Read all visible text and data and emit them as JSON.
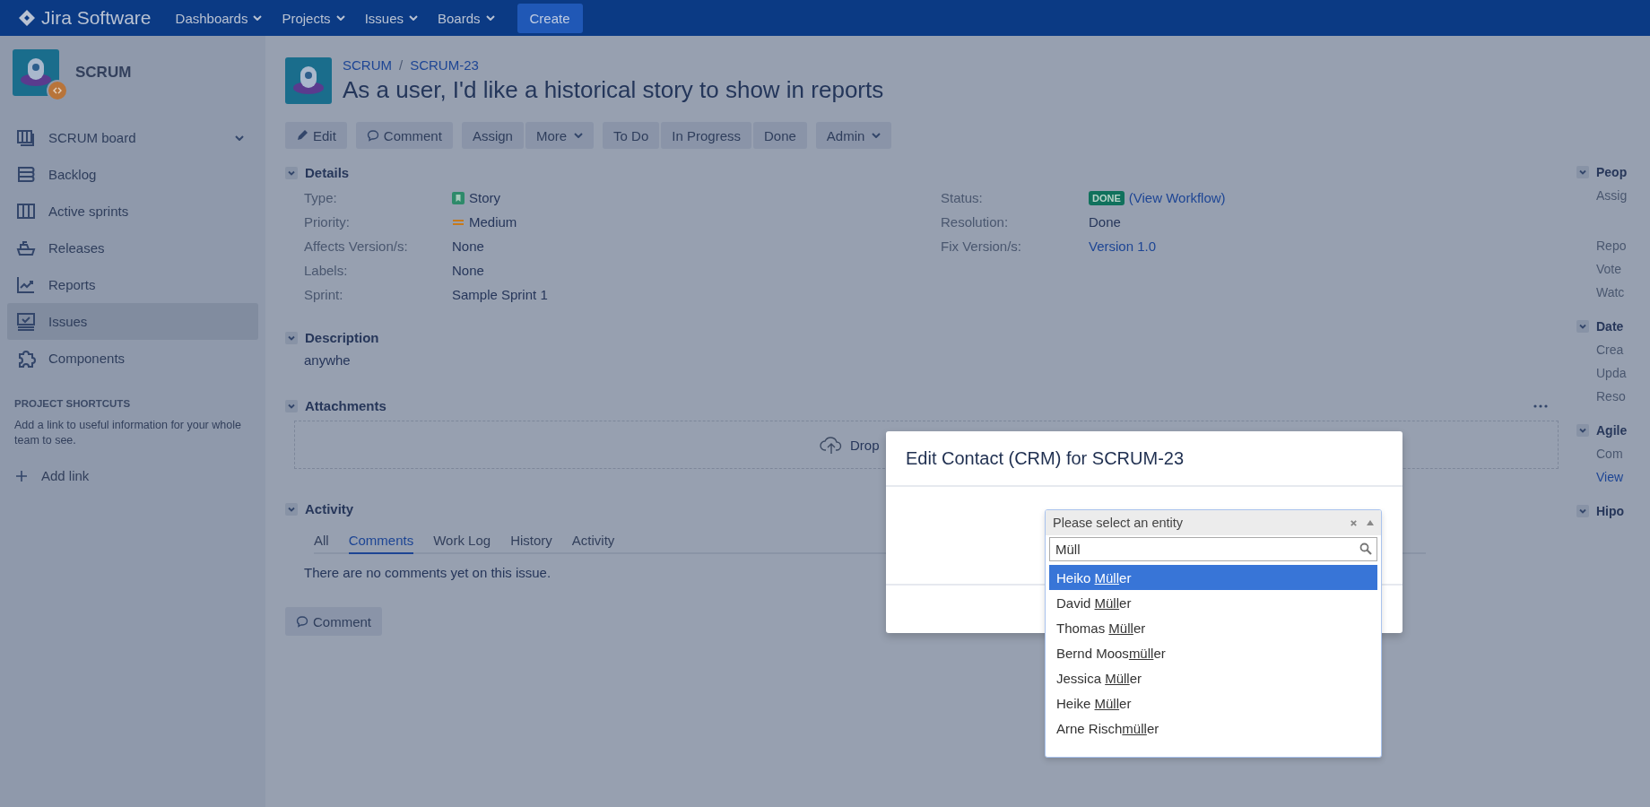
{
  "top_nav": {
    "logo": "Jira Software",
    "menus": [
      {
        "label": "Dashboards"
      },
      {
        "label": "Projects"
      },
      {
        "label": "Issues"
      },
      {
        "label": "Boards"
      }
    ],
    "create": "Create"
  },
  "sidebar": {
    "project": "SCRUM",
    "items": [
      {
        "label": "SCRUM board",
        "selected": false
      },
      {
        "label": "Backlog",
        "selected": false
      },
      {
        "label": "Active sprints",
        "selected": false
      },
      {
        "label": "Releases",
        "selected": false
      },
      {
        "label": "Reports",
        "selected": false
      },
      {
        "label": "Issues",
        "selected": true
      },
      {
        "label": "Components",
        "selected": false
      }
    ],
    "shortcuts_title": "PROJECT SHORTCUTS",
    "shortcuts_text": "Add a link to useful information for your whole team to see.",
    "add_link": "Add link"
  },
  "issue": {
    "breadcrumbs": [
      "SCRUM",
      "SCRUM-23"
    ],
    "breadcrumb_separator": "/",
    "title": "As a user, I'd like a historical story to show in reports"
  },
  "toolbar": [
    [
      {
        "label": "Edit",
        "menu": false
      }
    ],
    [
      {
        "label": "Comment",
        "menu": false
      }
    ],
    [
      {
        "label": "Assign",
        "menu": false
      },
      {
        "label": "More",
        "menu": true
      }
    ],
    [
      {
        "label": "To Do",
        "menu": false
      },
      {
        "label": "In Progress",
        "menu": false
      },
      {
        "label": "Done",
        "menu": false
      }
    ],
    [
      {
        "label": "Admin",
        "menu": true
      }
    ]
  ],
  "details": {
    "title": "Details",
    "left": [
      {
        "label": "Type:",
        "value": "Story",
        "kind": "story"
      },
      {
        "label": "Priority:",
        "value": "Medium",
        "kind": "priority"
      },
      {
        "label": "Affects Version/s:",
        "value": "None",
        "kind": "text"
      },
      {
        "label": "Labels:",
        "value": "None",
        "kind": "text"
      },
      {
        "label": "Sprint:",
        "value": "Sample Sprint 1",
        "kind": "text"
      }
    ],
    "right": [
      {
        "label": "Status:",
        "value": "DONE",
        "link": "(View Workflow)",
        "kind": "status"
      },
      {
        "label": "Resolution:",
        "value": "Done",
        "kind": "text"
      },
      {
        "label": "Fix Version/s:",
        "value": "Version 1.0",
        "kind": "link"
      }
    ]
  },
  "description": {
    "title": "Description",
    "text": "anywhe"
  },
  "attachments": {
    "title": "Attachments",
    "drop_text": "Drop"
  },
  "activity": {
    "title": "Activity",
    "tabs": [
      {
        "label": "All",
        "selected": false
      },
      {
        "label": "Comments",
        "selected": true
      },
      {
        "label": "Work Log",
        "selected": false
      },
      {
        "label": "History",
        "selected": false
      },
      {
        "label": "Activity",
        "selected": false
      }
    ],
    "empty_text": "There are no comments yet on this issue.",
    "comment_button": "Comment"
  },
  "right_panel": [
    {
      "title": "Peop",
      "items": [
        {
          "label": "Assig",
          "kind": "text"
        },
        {
          "label": "Repo",
          "kind": "text"
        },
        {
          "label": "Vote",
          "kind": "text"
        },
        {
          "label": "Watc",
          "kind": "text"
        }
      ]
    },
    {
      "title": "Date",
      "items": [
        {
          "label": "Crea",
          "kind": "text"
        },
        {
          "label": "Upda",
          "kind": "text"
        },
        {
          "label": "Reso",
          "kind": "text"
        }
      ]
    },
    {
      "title": "Agile",
      "items": [
        {
          "label": "Com",
          "kind": "text"
        },
        {
          "label": "View",
          "kind": "link"
        }
      ]
    },
    {
      "title": "Hipo"
    }
  ],
  "modal": {
    "title": "Edit Contact (CRM) for SCRUM-23",
    "select_placeholder": "Please select an entity",
    "search_value": "Müll",
    "options": [
      {
        "before": "Heiko ",
        "match": "Müll",
        "after": "er",
        "selected": true
      },
      {
        "before": "David ",
        "match": "Müll",
        "after": "er",
        "selected": false
      },
      {
        "before": "Thomas ",
        "match": "Müll",
        "after": "er",
        "selected": false
      },
      {
        "before": "Bernd Moos",
        "match": "müll",
        "after": "er",
        "selected": false
      },
      {
        "before": "Jessica ",
        "match": "Müll",
        "after": "er",
        "selected": false
      },
      {
        "before": "Heike ",
        "match": "Müll",
        "after": "er",
        "selected": false
      },
      {
        "before": "Arne Risch",
        "match": "müll",
        "after": "er",
        "selected": false
      }
    ]
  }
}
